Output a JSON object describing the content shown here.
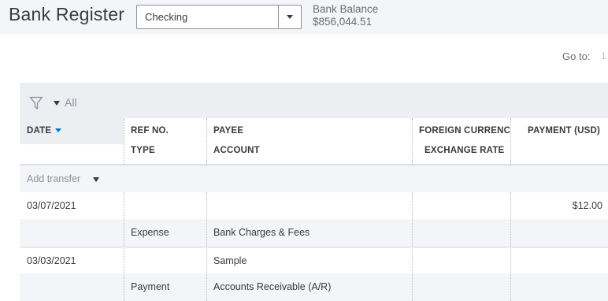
{
  "header": {
    "title": "Bank Register",
    "account_select": "Checking",
    "balance_label": "Bank Balance",
    "balance_value": "$856,044.51"
  },
  "goto": {
    "label": "Go to:",
    "value": "1"
  },
  "filter": {
    "label": "All"
  },
  "columns": {
    "date": "DATE",
    "ref_no": "REF NO.",
    "type": "TYPE",
    "payee": "PAYEE",
    "account": "ACCOUNT",
    "foreign_currency": "FOREIGN CURRENC",
    "exchange_rate": "EXCHANGE RATE",
    "payment": "PAYMENT (USD)"
  },
  "add_transfer": "Add transfer",
  "transactions": [
    {
      "date": "03/07/2021",
      "ref_no": "",
      "payee": "",
      "payment": "$12.00",
      "type": "Expense",
      "account": "Bank Charges & Fees"
    },
    {
      "date": "03/03/2021",
      "ref_no": "",
      "payee": "Sample",
      "payment": "",
      "type": "Payment",
      "account": "Accounts Receivable (A/R)"
    }
  ],
  "colors": {
    "accent": "#0077c5",
    "header_bg": "#f4f5f8",
    "filter_bg": "#eceef1"
  },
  "icons": {
    "filter": "funnel-icon",
    "dropdown": "caret-down-icon"
  }
}
